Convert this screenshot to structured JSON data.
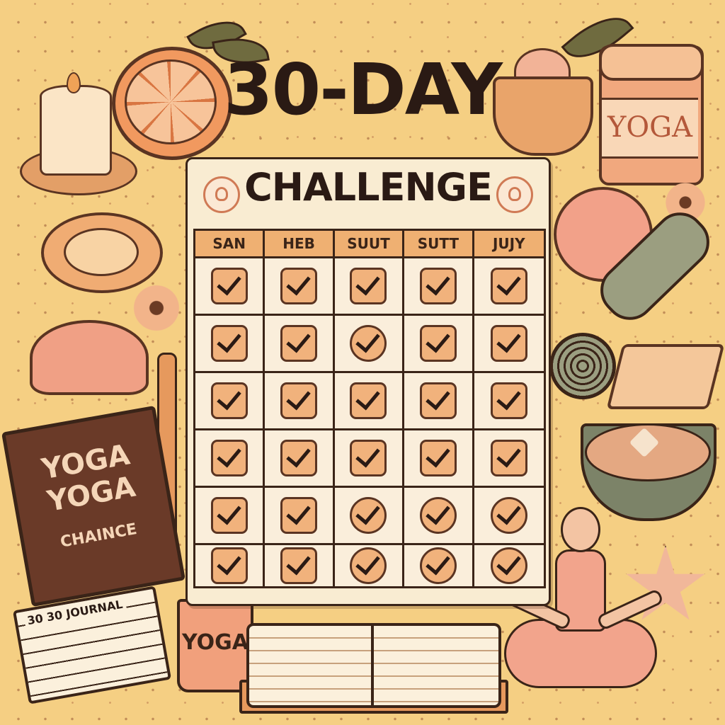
{
  "title": {
    "main": "30-DAY",
    "sub": "CHALLENGE"
  },
  "calendar": {
    "headers": [
      "SAN",
      "HEB",
      "SUUT",
      "SUTT",
      "JUJY"
    ],
    "rows": 6,
    "cols": 5
  },
  "labels": {
    "jar": "YOGA",
    "book_line1": "YOGA",
    "book_line2": "YOGA",
    "book_line3": "CHAINCE",
    "cup": "YOGA",
    "notepad": "30 30 JOURNAL"
  },
  "colors": {
    "background": "#f5cf83",
    "ink": "#2a1a14",
    "accent": "#efb072"
  }
}
